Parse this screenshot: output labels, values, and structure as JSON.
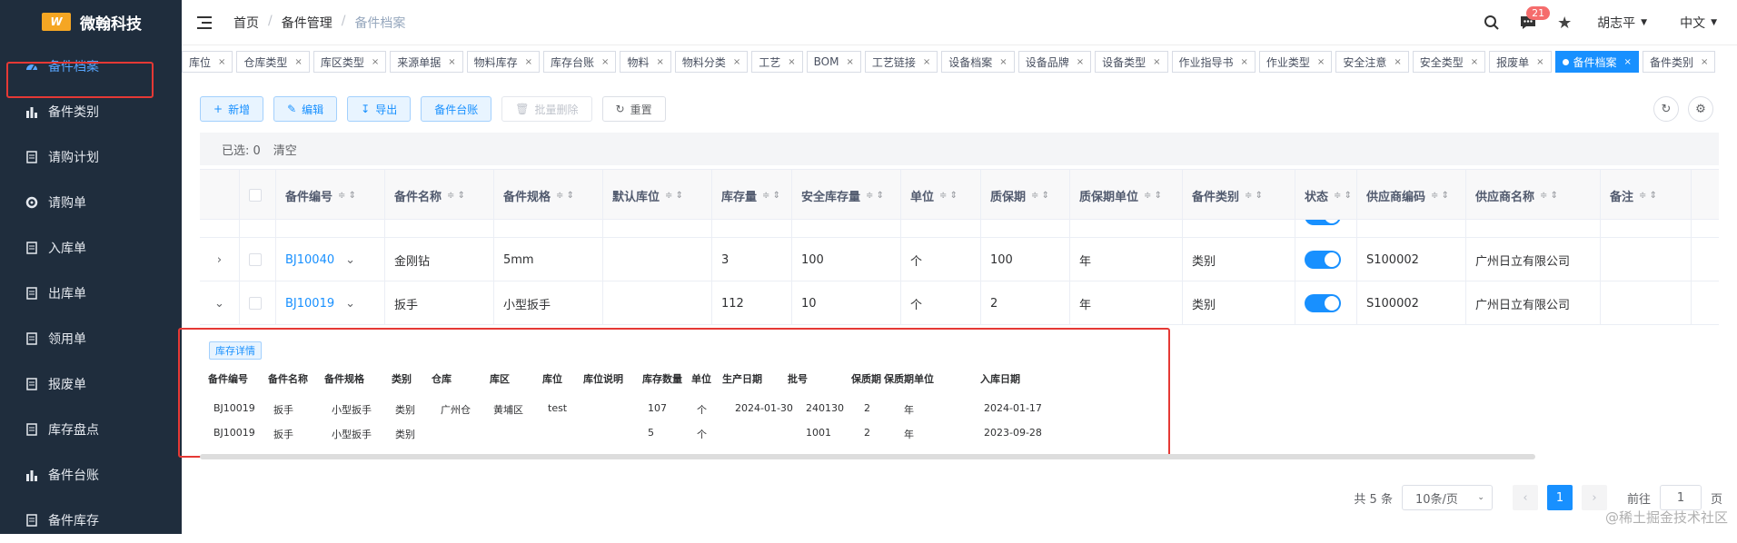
{
  "app": {
    "logo_mark": "W",
    "title": "微翰科技"
  },
  "sidebar": {
    "items": [
      {
        "label": "备件档案",
        "icon": "dashboard-icon"
      },
      {
        "label": "备件类别",
        "icon": "bar-chart-icon"
      },
      {
        "label": "请购计划",
        "icon": "document-icon"
      },
      {
        "label": "请购单",
        "icon": "cog-icon"
      },
      {
        "label": "入库单",
        "icon": "document-icon"
      },
      {
        "label": "出库单",
        "icon": "document-icon"
      },
      {
        "label": "领用单",
        "icon": "document-icon"
      },
      {
        "label": "报废单",
        "icon": "document-icon"
      },
      {
        "label": "库存盘点",
        "icon": "document-icon"
      },
      {
        "label": "备件台账",
        "icon": "bar-chart-icon"
      },
      {
        "label": "备件库存",
        "icon": "document-icon"
      }
    ]
  },
  "breadcrumb": {
    "home": "首页",
    "parent": "备件管理",
    "current": "备件档案"
  },
  "header": {
    "badge": "21",
    "user": "胡志平",
    "lang": "中文"
  },
  "tags": [
    "库位",
    "仓库类型",
    "库区类型",
    "来源单据",
    "物料库存",
    "库存台账",
    "物料",
    "物料分类",
    "工艺",
    "BOM",
    "工艺链接",
    "设备档案",
    "设备品牌",
    "设备类型",
    "作业指导书",
    "作业类型",
    "安全注意",
    "安全类型",
    "报废单",
    "备件档案",
    "备件类别"
  ],
  "active_tag": "备件档案",
  "toolbar": {
    "add": "新增",
    "edit": "编辑",
    "export": "导出",
    "ledger": "备件台账",
    "batch_delete": "批量删除",
    "reset": "重置"
  },
  "selection": {
    "label": "已选: 0",
    "clear": "清空"
  },
  "table": {
    "headers": [
      "备件编号",
      "备件名称",
      "备件规格",
      "默认库位",
      "库存量",
      "安全库存量",
      "单位",
      "质保期",
      "质保期单位",
      "备件类别",
      "状态",
      "供应商编码",
      "供应商名称",
      "备注"
    ],
    "rows": [
      {
        "code": "BJ10040",
        "name": "金刚钻",
        "spec": "5mm",
        "loc": "",
        "stock": "3",
        "safe": "100",
        "unit": "个",
        "warranty": "100",
        "wunit": "年",
        "cat": "类别",
        "sup_code": "S100002",
        "sup_name": "广州日立有限公司"
      },
      {
        "code": "BJ10019",
        "name": "扳手",
        "spec": "小型扳手",
        "loc": "",
        "stock": "112",
        "safe": "10",
        "unit": "个",
        "warranty": "2",
        "wunit": "年",
        "cat": "类别",
        "sup_code": "S100002",
        "sup_name": "广州日立有限公司"
      }
    ]
  },
  "detail": {
    "tag": "库存详情",
    "headers": [
      "备件编号",
      "备件名称",
      "备件规格",
      "类别",
      "仓库",
      "库区",
      "库位",
      "库位说明",
      "库存数量",
      "单位",
      "生产日期",
      "批号",
      "保质期",
      "保质期单位",
      "入库日期"
    ],
    "rows": [
      [
        "BJ10019",
        "扳手",
        "小型扳手",
        "类别",
        "广州仓",
        "黄埔区",
        "test",
        "",
        "107",
        "个",
        "2024-01-30",
        "240130",
        "2",
        "年",
        "2024-01-17"
      ],
      [
        "BJ10019",
        "扳手",
        "小型扳手",
        "类别",
        "",
        "",
        "",
        "",
        "5",
        "个",
        "",
        "1001",
        "2",
        "年",
        "2023-09-28"
      ]
    ]
  },
  "pager": {
    "total": "共 5 条",
    "size": "10条/页",
    "page": "1",
    "goto": "前往",
    "goto_val": "1",
    "suffix": "页"
  },
  "watermark": "@稀土掘金技术社区"
}
